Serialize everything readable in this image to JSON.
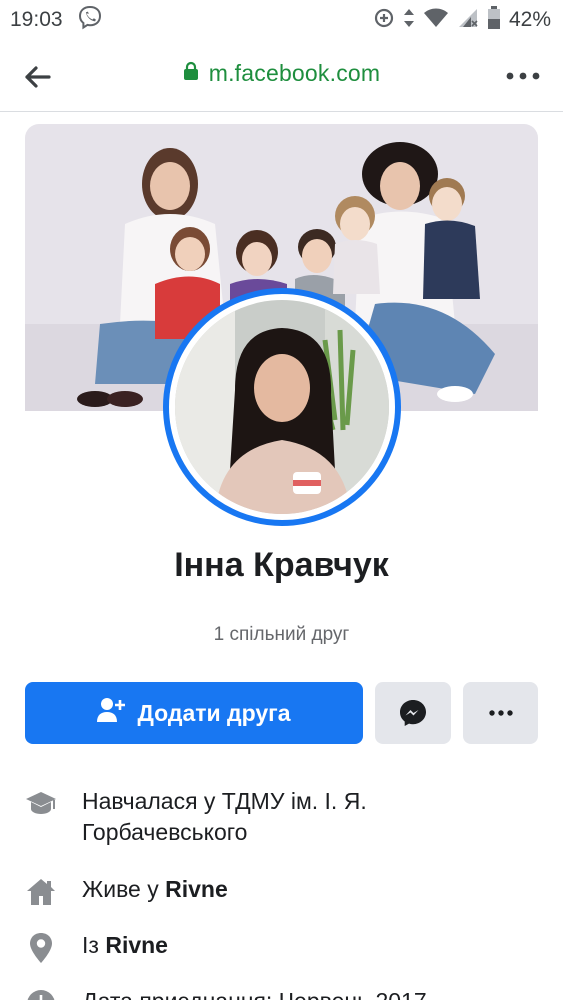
{
  "status_bar": {
    "time": "19:03",
    "battery": "42%",
    "icons": [
      "viber-icon",
      "data-saver-icon",
      "data-arrows-icon",
      "wifi-icon",
      "signal-icon",
      "battery-icon"
    ]
  },
  "browser": {
    "url": "m.facebook.com",
    "secure": true,
    "accent": "#1e8e3e"
  },
  "profile": {
    "name": "Інна Кравчук",
    "mutual_friends": "1 спільний друг"
  },
  "actions": {
    "add_friend_label": "Додати друга",
    "accent": "#1877f2"
  },
  "info": {
    "education": {
      "line1": "Навчалася у ТДМУ ім. І. Я.",
      "line2": "Горбачевського"
    },
    "lives": {
      "prefix": "Живе у ",
      "place": "Rivne"
    },
    "from": {
      "prefix": "Із ",
      "place": "Rivne"
    },
    "joined": {
      "text": "Дата приєднання: Червень 2017"
    }
  }
}
